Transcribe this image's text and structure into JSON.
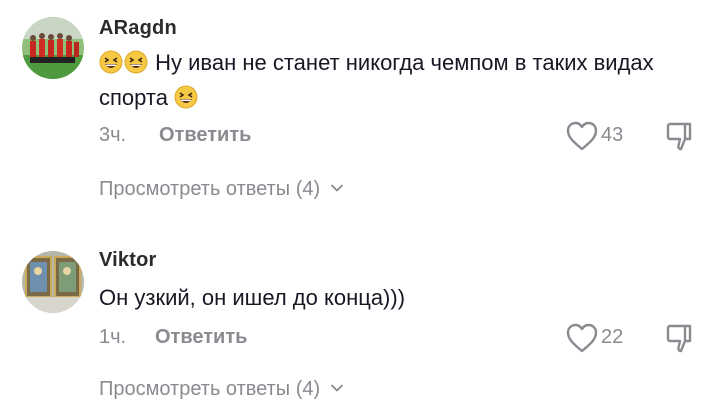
{
  "comments": [
    {
      "username": "ARagdn",
      "text_before": "Ну иван не станет никогда чемпом в таких видах спорта",
      "time": "3ч.",
      "reply_label": "Ответить",
      "likes": "43",
      "view_replies": "Просмотреть ответы (4)",
      "avatar_icon": "avatar-team-photo",
      "emoji_icon": "grinning-squinting-face-emoji"
    },
    {
      "username": "Viktor",
      "text_before": "Он узкий, он ишел до конца)))",
      "time": "1ч.",
      "reply_label": "Ответить",
      "likes": "22",
      "view_replies": "Просмотреть ответы (4)",
      "avatar_icon": "avatar-framed-pictures"
    }
  ],
  "colors": {
    "muted": "#8a8b91",
    "text": "#161823",
    "emoji_yellow": "#f6c945"
  }
}
